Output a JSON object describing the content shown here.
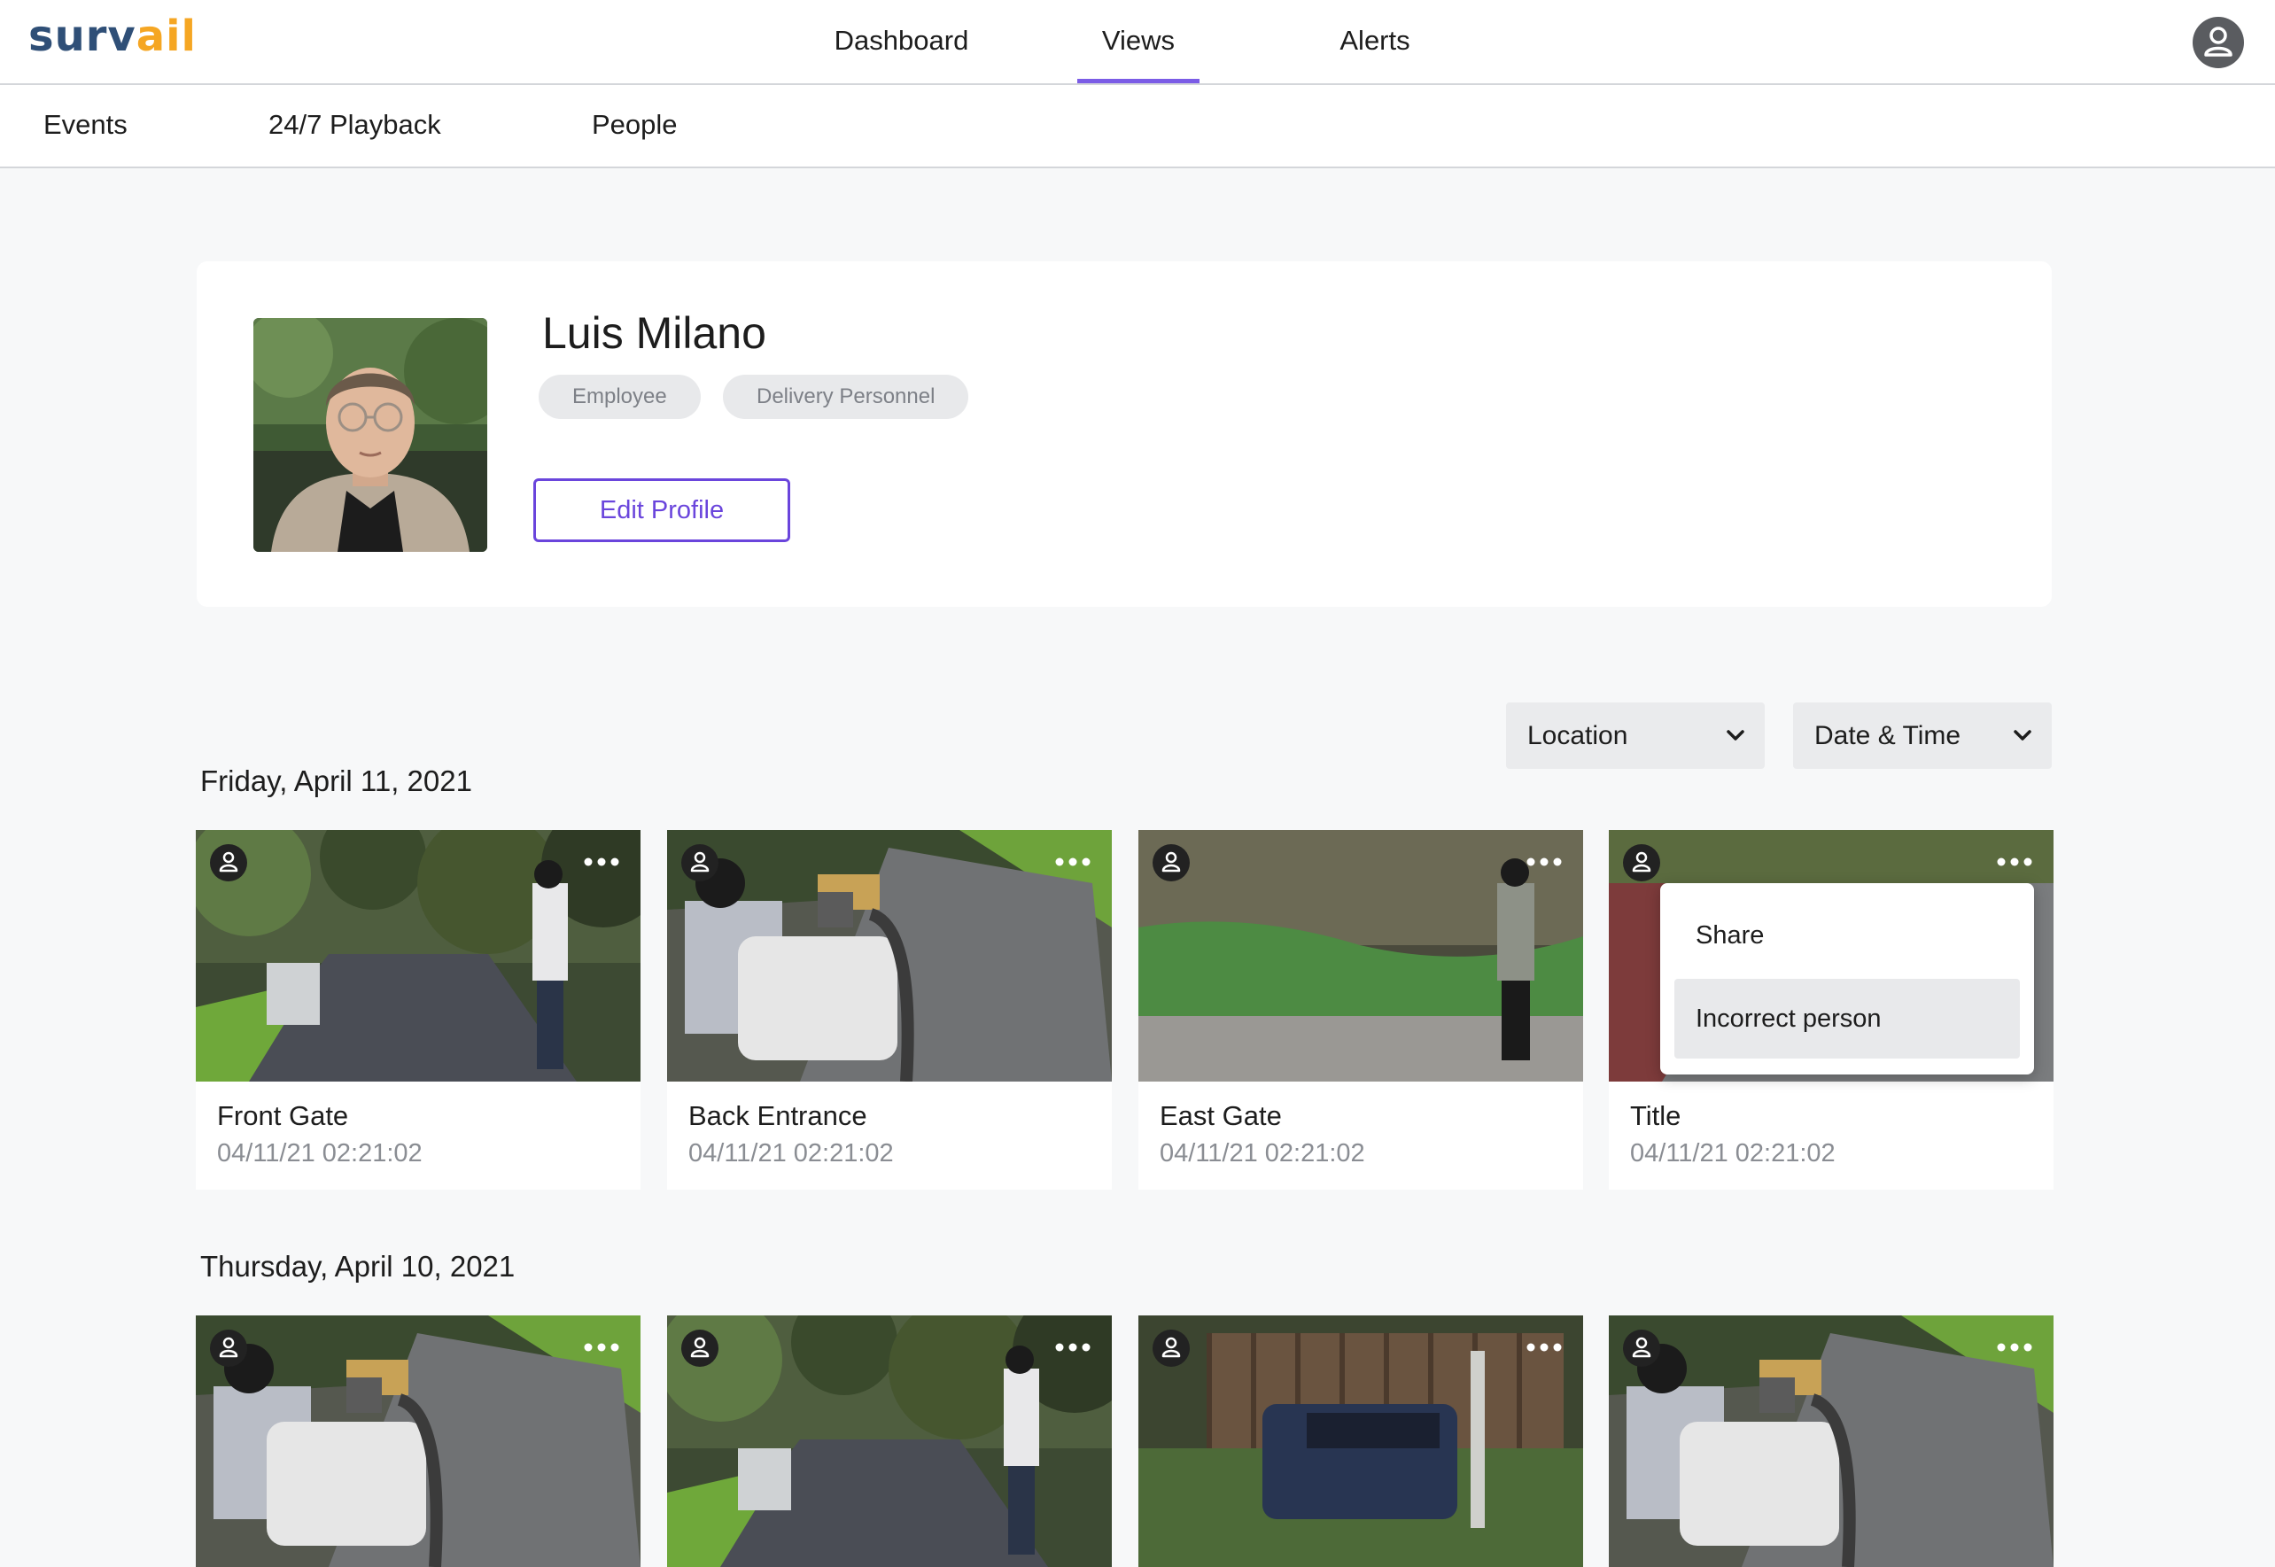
{
  "app": {
    "logo_main": "surv",
    "logo_accent": "ail",
    "colors": {
      "accent": "#6a45dc",
      "brand_blue": "#2f4f77",
      "brand_orange": "#f5a623"
    }
  },
  "main_nav": {
    "tabs": [
      {
        "label": "Dashboard",
        "active": false
      },
      {
        "label": "Views",
        "active": true
      },
      {
        "label": "Alerts",
        "active": false
      }
    ],
    "user_icon": "user-avatar-icon"
  },
  "sub_nav": {
    "items": [
      {
        "label": "Events"
      },
      {
        "label": "24/7 Playback"
      },
      {
        "label": "People"
      }
    ]
  },
  "profile": {
    "name": "Luis Milano",
    "tags": [
      "Employee",
      "Delivery Personnel"
    ],
    "edit_label": "Edit Profile"
  },
  "filters": {
    "location_label": "Location",
    "datetime_label": "Date & Time"
  },
  "sections": [
    {
      "date": "Friday, April 11, 2021",
      "cards": [
        {
          "title": "Front Gate",
          "time": "04/11/21 02:21:02",
          "scene": "path-person"
        },
        {
          "title": "Back Entrance",
          "time": "04/11/21 02:21:02",
          "scene": "cart-person"
        },
        {
          "title": "East Gate",
          "time": "04/11/21 02:21:02",
          "scene": "hedge-person"
        },
        {
          "title": "Title",
          "time": "04/11/21 02:21:02",
          "scene": "road-person"
        }
      ]
    },
    {
      "date": "Thursday, April 10, 2021",
      "cards": [
        {
          "scene": "cart-person"
        },
        {
          "scene": "path-person"
        },
        {
          "scene": "car-fence"
        },
        {
          "scene": "cart-person"
        }
      ]
    }
  ],
  "context_menu": {
    "items": [
      {
        "label": "Share",
        "highlighted": false
      },
      {
        "label": "Incorrect person",
        "highlighted": true
      }
    ]
  }
}
